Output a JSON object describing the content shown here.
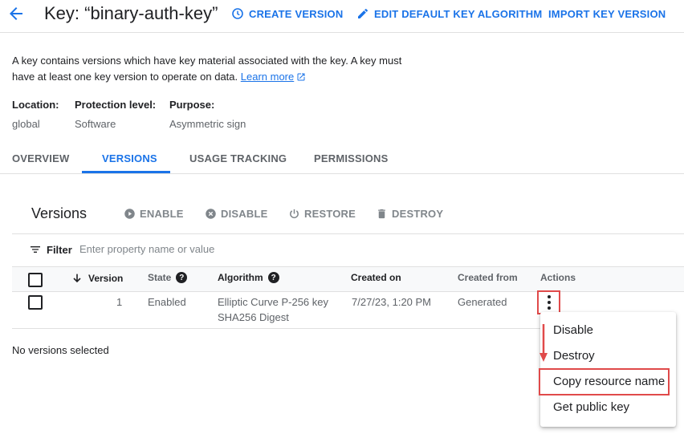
{
  "header": {
    "title": "Key: “binary-auth-key”",
    "actions": {
      "create_version": "CREATE VERSION",
      "edit_default_algorithm": "EDIT DEFAULT KEY ALGORITHM",
      "import_version": "IMPORT KEY VERSION"
    }
  },
  "description": {
    "text": "A key contains versions which have key material associated with the key. A key must have at least one key version to operate on data.",
    "learn_more": "Learn more"
  },
  "meta": {
    "location_label": "Location:",
    "location_value": "global",
    "protection_label": "Protection level:",
    "protection_value": "Software",
    "purpose_label": "Purpose:",
    "purpose_value": "Asymmetric sign"
  },
  "tabs": [
    {
      "label": "OVERVIEW",
      "active": false
    },
    {
      "label": "VERSIONS",
      "active": true
    },
    {
      "label": "USAGE TRACKING",
      "active": false
    },
    {
      "label": "PERMISSIONS",
      "active": false
    }
  ],
  "versions": {
    "title": "Versions",
    "toolbar": {
      "enable": "ENABLE",
      "disable": "DISABLE",
      "restore": "RESTORE",
      "destroy": "DESTROY"
    },
    "filter_label": "Filter",
    "filter_placeholder": "Enter property name or value",
    "columns": {
      "version": "Version",
      "state": "State",
      "algorithm": "Algorithm",
      "created_on": "Created on",
      "created_from": "Created from",
      "actions": "Actions"
    },
    "rows": [
      {
        "version": "1",
        "state": "Enabled",
        "algorithm_line1": "Elliptic Curve P-256 key",
        "algorithm_line2": "SHA256 Digest",
        "created_on": "7/27/23, 1:20 PM",
        "created_from": "Generated"
      }
    ],
    "selection_status": "No versions selected"
  },
  "action_menu": {
    "items": [
      "Disable",
      "Destroy",
      "Copy resource name",
      "Get public key"
    ],
    "highlighted": "Copy resource name"
  },
  "colors": {
    "accent": "#1a73e8",
    "highlight": "#e04a4a"
  }
}
